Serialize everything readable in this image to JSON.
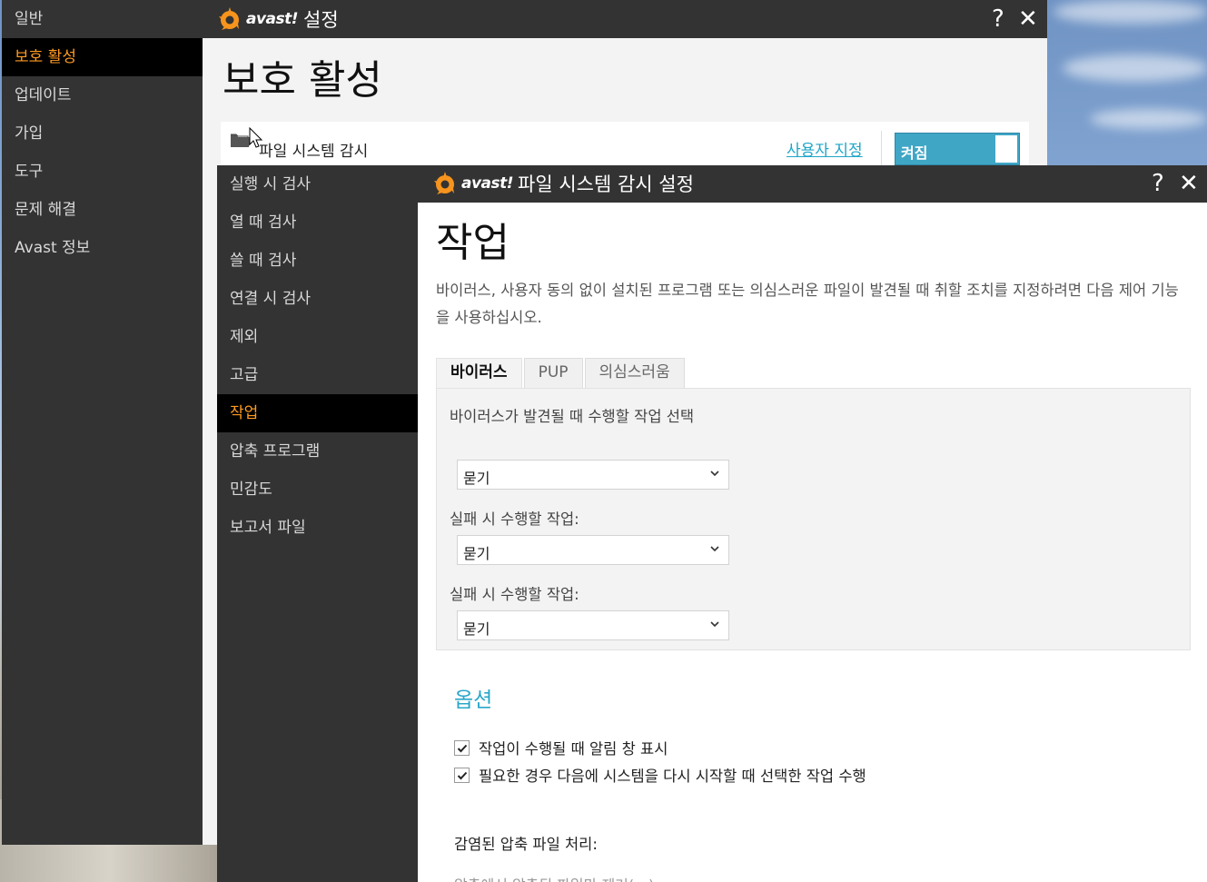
{
  "main_window": {
    "title": "설정",
    "logo_text": "avast!",
    "sidebar": {
      "items": [
        {
          "label": "일반"
        },
        {
          "label": "보호 활성"
        },
        {
          "label": "업데이트"
        },
        {
          "label": "가입"
        },
        {
          "label": "도구"
        },
        {
          "label": "문제 해결"
        },
        {
          "label": "Avast 정보"
        }
      ],
      "active_index": 1
    },
    "page_title": "보호 활성",
    "shield_row": {
      "label": "파일 시스템 감시",
      "customize_link": "사용자 지정",
      "toggle_label": "켜짐",
      "toggle_on": true
    },
    "help_symbol": "?",
    "close_symbol": "✕"
  },
  "dialog": {
    "title": "파일 시스템 감시 설정",
    "logo_text": "avast!",
    "sidebar": {
      "items": [
        {
          "label": "실행 시 검사"
        },
        {
          "label": "열 때 검사"
        },
        {
          "label": "쓸 때 검사"
        },
        {
          "label": "연결 시 검사"
        },
        {
          "label": "제외"
        },
        {
          "label": "고급"
        },
        {
          "label": "작업"
        },
        {
          "label": "압축 프로그램"
        },
        {
          "label": "민감도"
        },
        {
          "label": "보고서 파일"
        }
      ],
      "active_index": 6
    },
    "page_title": "작업",
    "description": "바이러스, 사용자 동의 없이 설치된 프로그램 또는 의심스러운 파일이 발견될 때 취할 조치를 지정하려면 다음 제어 기능을 사용하십시오.",
    "tabs": [
      {
        "label": "바이러스",
        "active": true
      },
      {
        "label": "PUP",
        "active": false
      },
      {
        "label": "의심스러움",
        "active": false
      }
    ],
    "virus_panel": {
      "prompt": "바이러스가 발견될 때 수행할 작업 선택",
      "primary_select": "묻기",
      "fallback_label_1": "실패 시 수행할 작업:",
      "fallback_select_1": "묻기",
      "fallback_label_2": "실패 시 수행할 작업:",
      "fallback_select_2": "묻기"
    },
    "options": {
      "title": "옵션",
      "checkbox_1": {
        "label": "작업이 수행될 때 알림 창 표시",
        "checked": true
      },
      "checkbox_2": {
        "label": "필요한 경우 다음에 시스템을 다시 시작할 때 선택한 작업 수행",
        "checked": true
      },
      "archive_label": "감염된 압축 파일 처리:",
      "archive_option_1": "압축에서 압축된 파일만 제거(…)"
    },
    "help_symbol": "?",
    "close_symbol": "✕"
  },
  "colors": {
    "accent_orange": "#ff9a1f",
    "link_blue": "#1fa5c8",
    "toggle_blue": "#3fa6c6",
    "sidebar_bg": "#333333"
  }
}
